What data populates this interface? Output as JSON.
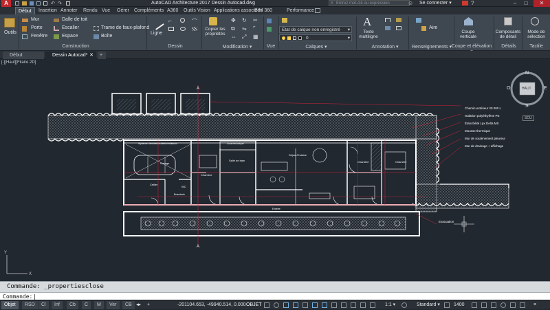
{
  "titlebar": {
    "app_icon": "A",
    "title": "AutoCAD Architecture 2017   Dessin Autocad.dwg",
    "search_placeholder": "Entrez mot-clé ou expression",
    "sign_in": "Se connecter",
    "icons": [
      "autocad-logo-icon",
      "search-icon",
      "user-icon",
      "exchange-icon",
      "help-icon",
      "minimize-icon",
      "maximize-icon",
      "close-icon"
    ]
  },
  "ribbon_tabs": [
    "Début",
    "Insertion",
    "Annoter",
    "Rendu",
    "Vue",
    "Gérer",
    "Compléments",
    "A360",
    "Outils Vision",
    "Applications associées",
    "BIM 360",
    "Performance"
  ],
  "ribbon": {
    "outils": "Outils",
    "construction": {
      "items": [
        "Mur",
        "Porte",
        "Fenêtre",
        "Dalle de toit",
        "Escalier",
        "Espace",
        "Trame de faux-plafond",
        "Boîte"
      ],
      "label": "Construction"
    },
    "dessin": {
      "ligne": "Ligne",
      "label": "Dessin"
    },
    "modification": {
      "copy_props": "Copier les propriétés",
      "label": "Modification"
    },
    "vue": {
      "label": "Vue"
    },
    "calques": {
      "state": "Etat de calque non enregistré",
      "layer": "0",
      "label": "Calques"
    },
    "annotation": {
      "text": "Texte multiligne",
      "label": "Annotation"
    },
    "renseignements": {
      "area": "Aire",
      "label": "Renseignements"
    },
    "coupe": {
      "section": "Coupe verticale",
      "label": "Coupe et élévation"
    },
    "details": {
      "components": "Composants de détail",
      "label": "Détails"
    },
    "tactile": {
      "select_mode": "Mode de sélection",
      "label": "Tactile"
    }
  },
  "doc_tabs": [
    "Début",
    "Dessin Autocad*"
  ],
  "viewport": {
    "label": "[-][Haut][Filaire 2D]",
    "compass": {
      "n": "N",
      "s": "S",
      "e": "E",
      "o": "O",
      "center": "HAUT",
      "scu": "SCU"
    },
    "legend": [
      "Chemin extérieur 20 000 L",
      "Isolation polyéthylène PE",
      "Étanchéité Lpx Delta MS",
      "Mousse thermique",
      "Mur de soutènement pleureur",
      "Mur de drainage + affichage"
    ],
    "drain_label": "Evacuation",
    "rooms": {
      "garage": "Garage",
      "chambre1": "Chambre",
      "bain": "Salle de bain",
      "sejour": "Séjour/Cuisine",
      "chambre2": "Chambre",
      "chambre3": "Chambre",
      "entree": "Entrée",
      "cellier": "Cellier",
      "wc": "WC",
      "buanderie": "Buanderie",
      "technique": "Local technique",
      "section_note": "Système d'entrées/sorties/ventilation"
    }
  },
  "command": {
    "history": "Commande: _propertiesclose",
    "prompt": "Commande:"
  },
  "statusbar": {
    "layouts": [
      "Objet",
      "RSD",
      "Cl",
      "Inf",
      "Cb",
      "C",
      "M",
      "Ver",
      "CB"
    ],
    "coords": "-201104.653, -49940.514, 0.000",
    "model": "OBJET",
    "scale": "1:1",
    "style": "Standard",
    "elevation": "1400"
  }
}
